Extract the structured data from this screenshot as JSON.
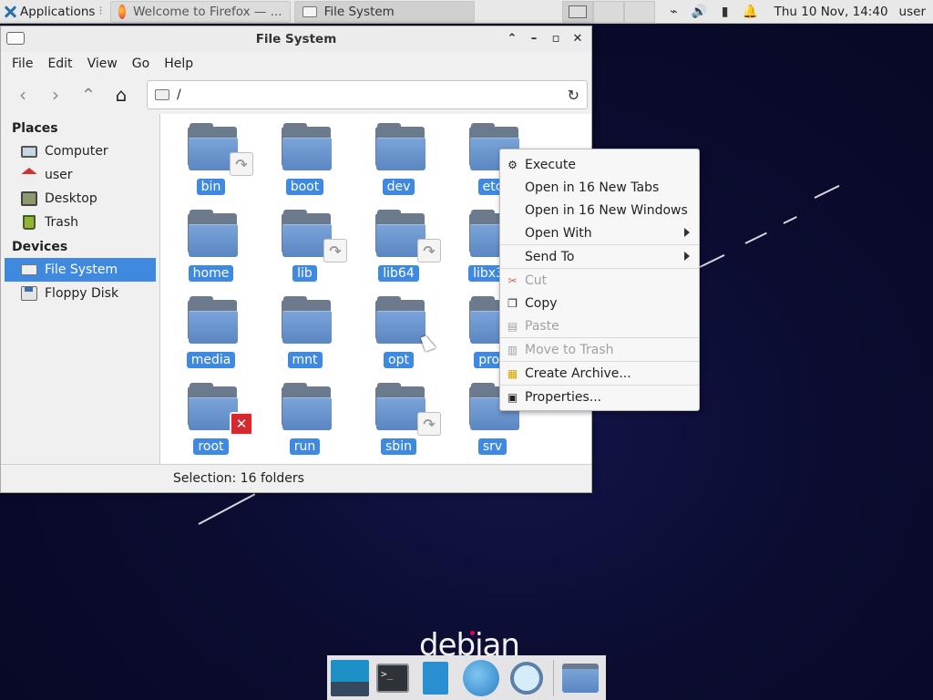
{
  "top_panel": {
    "applications_label": "Applications",
    "tasks": [
      {
        "label": "Welcome to Firefox — ...",
        "icon": "firefox-icon"
      },
      {
        "label": "File System",
        "icon": "file-system-icon"
      }
    ],
    "clock": "Thu 10 Nov, 14:40",
    "user": "user"
  },
  "window": {
    "title": "File System",
    "menu": [
      "File",
      "Edit",
      "View",
      "Go",
      "Help"
    ],
    "location": "/"
  },
  "sidebar": {
    "places_header": "Places",
    "places": [
      {
        "label": "Computer",
        "icon": "computer-icon"
      },
      {
        "label": "user",
        "icon": "home-icon"
      },
      {
        "label": "Desktop",
        "icon": "desktop-icon"
      },
      {
        "label": "Trash",
        "icon": "trash-icon"
      }
    ],
    "devices_header": "Devices",
    "devices": [
      {
        "label": "File System",
        "icon": "drive-icon",
        "selected": true
      },
      {
        "label": "Floppy Disk",
        "icon": "floppy-icon"
      }
    ]
  },
  "files": [
    {
      "name": "bin",
      "emblem": "symlink"
    },
    {
      "name": "boot",
      "emblem": ""
    },
    {
      "name": "dev",
      "emblem": ""
    },
    {
      "name": "etc",
      "emblem": ""
    },
    {
      "name": "home",
      "emblem": ""
    },
    {
      "name": "lib",
      "emblem": "symlink"
    },
    {
      "name": "lib64",
      "emblem": "symlink"
    },
    {
      "name": "libx32",
      "emblem": ""
    },
    {
      "name": "media",
      "emblem": ""
    },
    {
      "name": "mnt",
      "emblem": ""
    },
    {
      "name": "opt",
      "emblem": ""
    },
    {
      "name": "proc",
      "emblem": ""
    },
    {
      "name": "root",
      "emblem": "denied"
    },
    {
      "name": "run",
      "emblem": ""
    },
    {
      "name": "sbin",
      "emblem": "symlink"
    },
    {
      "name": "srv",
      "emblem": ""
    }
  ],
  "status": "Selection: 16 folders",
  "context_menu": [
    {
      "label": "Execute",
      "icon": "execute-icon",
      "disabled": false,
      "submenu": false
    },
    {
      "label": "Open in 16 New Tabs",
      "icon": "",
      "disabled": false,
      "submenu": false
    },
    {
      "label": "Open in 16 New Windows",
      "icon": "",
      "disabled": false,
      "submenu": false
    },
    {
      "label": "Open With",
      "icon": "",
      "disabled": false,
      "submenu": true,
      "sep_after": true
    },
    {
      "label": "Send To",
      "icon": "",
      "disabled": false,
      "submenu": true,
      "sep_after": true
    },
    {
      "label": "Cut",
      "icon": "scissors-icon",
      "disabled": true,
      "submenu": false
    },
    {
      "label": "Copy",
      "icon": "copy-icon",
      "disabled": false,
      "submenu": false
    },
    {
      "label": "Paste",
      "icon": "paste-icon",
      "disabled": true,
      "submenu": false,
      "sep_after": true
    },
    {
      "label": "Move to Trash",
      "icon": "trash-icon",
      "disabled": true,
      "submenu": false,
      "sep_after": true
    },
    {
      "label": "Create Archive...",
      "icon": "archive-icon",
      "disabled": false,
      "submenu": false,
      "sep_after": true
    },
    {
      "label": "Properties...",
      "icon": "properties-icon",
      "disabled": false,
      "submenu": false
    }
  ],
  "desktop": {
    "logo_text": "debian"
  },
  "dock": [
    "show-desktop-icon",
    "terminal-icon",
    "file-manager-icon",
    "web-browser-icon",
    "app-finder-icon",
    "folder-icon"
  ],
  "colors": {
    "selection": "#3f8ae0",
    "folder": "#5a86c2",
    "desktop": "#0a0b2a"
  }
}
